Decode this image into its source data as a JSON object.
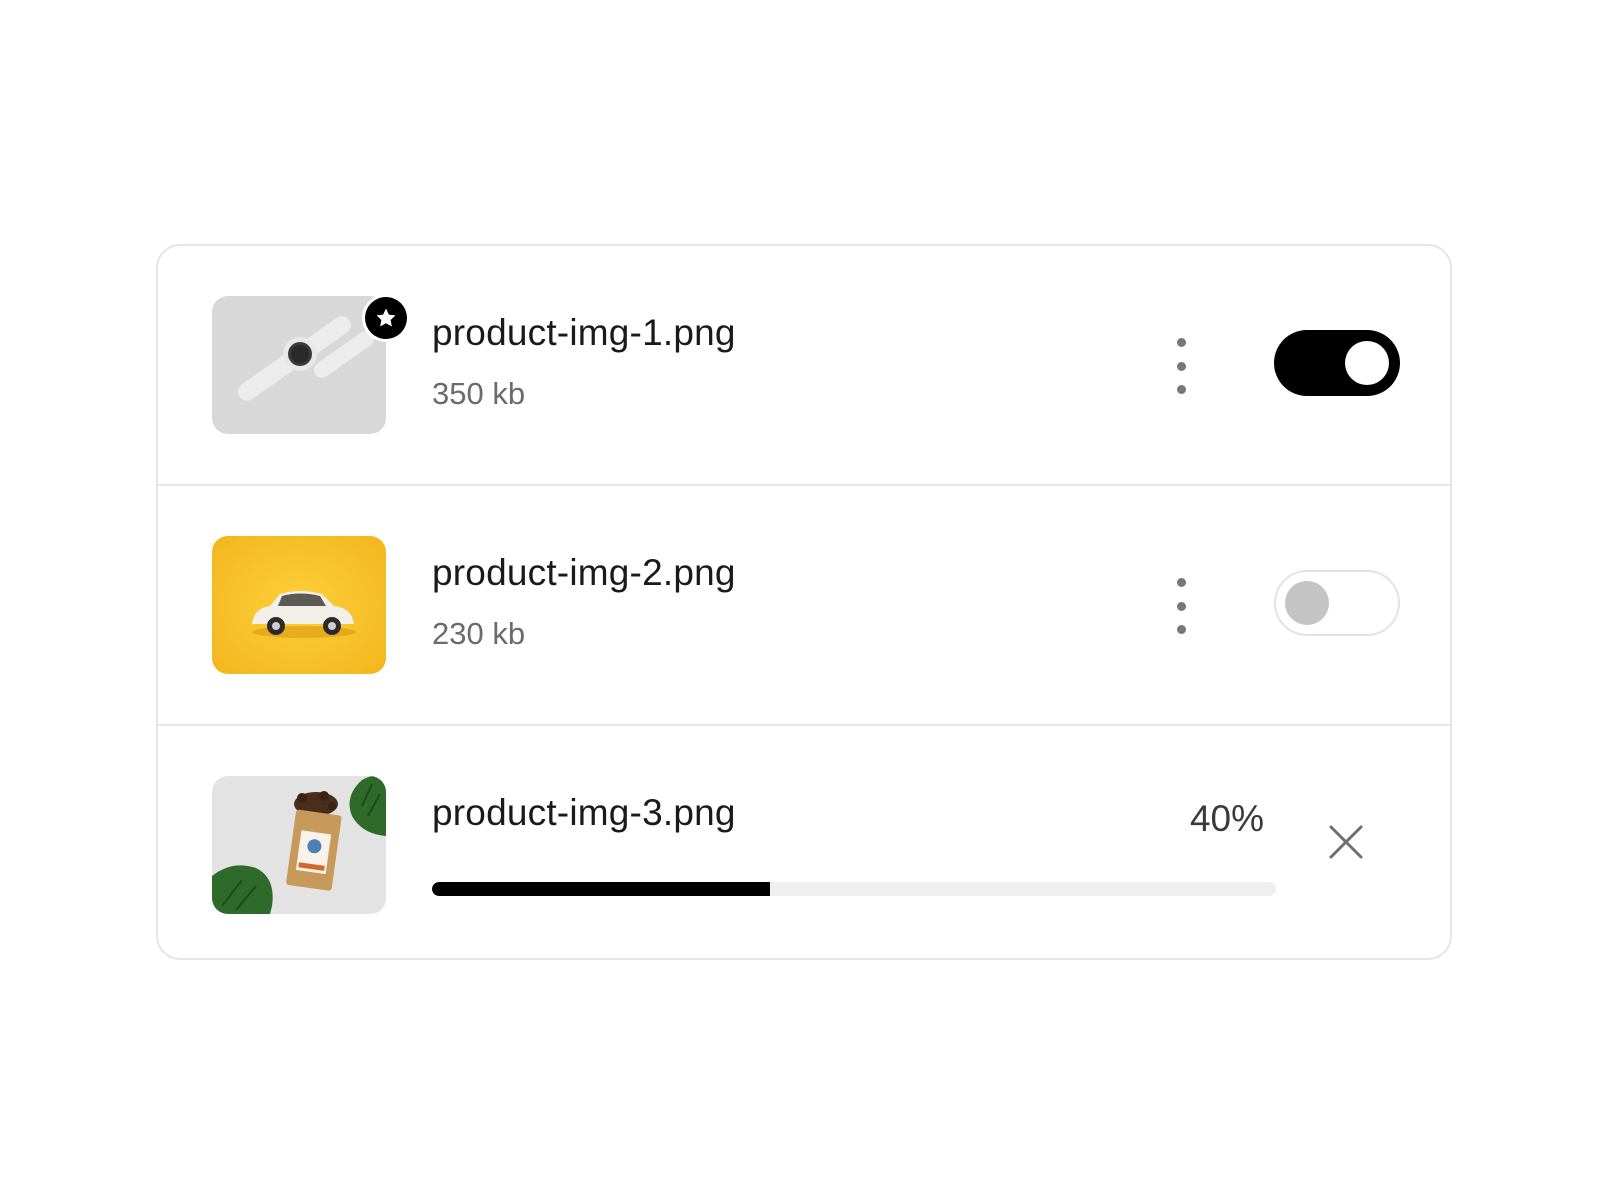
{
  "files": [
    {
      "name": "product-img-1.png",
      "size": "350 kb",
      "thumbnail": "watch-image",
      "starred": true,
      "enabled": true
    },
    {
      "name": "product-img-2.png",
      "size": "230 kb",
      "thumbnail": "car-image",
      "starred": false,
      "enabled": false
    },
    {
      "name": "product-img-3.png",
      "thumbnail": "coffee-bag-image",
      "uploading": true,
      "progress_label": "40%",
      "progress": 0.4
    }
  ],
  "icons": {
    "star": "star-icon",
    "more": "more-vertical-icon",
    "close": "close-icon"
  },
  "colors": {
    "accent": "#000000",
    "toggle_off_knob": "#c4c4c4",
    "track": "#efefef",
    "border": "#e6e6e6"
  }
}
